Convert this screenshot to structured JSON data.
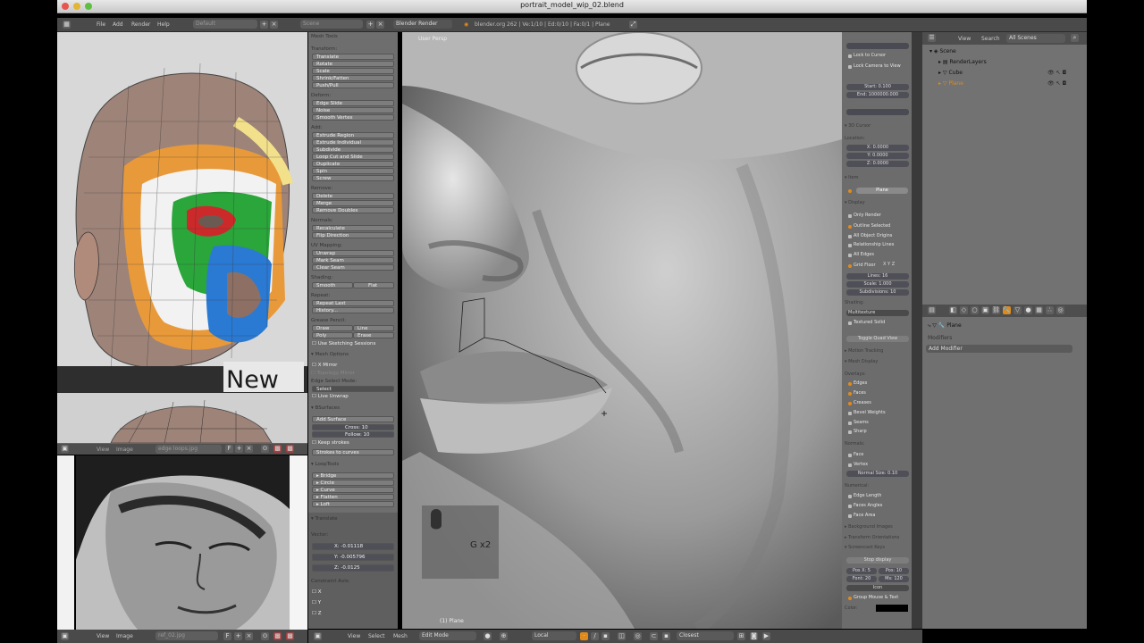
{
  "window": {
    "title": "portrait_model_wip_02.blend"
  },
  "info_header": {
    "menus": [
      "File",
      "Add",
      "Render",
      "Help"
    ],
    "layout": "Default",
    "scene": "Scene",
    "engine": "Blender Render",
    "stats": "blender.org 262 | Ve:1/10 | Ed:0/10 | Fa:0/1 | Plane"
  },
  "image_editor": {
    "overlay_text": "New",
    "image_name_top": "edge loops.jpg",
    "image_name_bottom": "ref_02.jpg",
    "menus": [
      "View",
      "Image"
    ]
  },
  "tool_shelf": {
    "header": "Mesh Tools",
    "groups": [
      {
        "title": "Transform:",
        "items": [
          "Translate",
          "Rotate",
          "Scale",
          "Shrink/Fatten",
          "Push/Pull"
        ]
      },
      {
        "title": "Deform:",
        "items": [
          "Edge Slide",
          "Noise",
          "Smooth Vertex"
        ]
      },
      {
        "title": "Add:",
        "items": [
          "Extrude Region",
          "Extrude Individual",
          "Subdivide",
          "Loop Cut and Slide",
          "Duplicate",
          "Spin",
          "Screw"
        ]
      },
      {
        "title": "Remove:",
        "items": [
          "Delete",
          "Merge",
          "Remove Doubles"
        ]
      },
      {
        "title": "Normals:",
        "items": [
          "Recalculate",
          "Flip Direction"
        ]
      },
      {
        "title": "UV Mapping:",
        "items": [
          "Unwrap",
          "Mark Seam",
          "Clear Seam"
        ]
      }
    ],
    "shading_label": "Shading:",
    "shading_smooth": "Smooth",
    "shading_flat": "Flat",
    "repeat_label": "Repeat:",
    "repeat_last": "Repeat Last",
    "history": "History...",
    "grease_label": "Grease Pencil:",
    "grease_draw": "Draw",
    "grease_line": "Line",
    "grease_poly": "Poly",
    "grease_erase": "Erase",
    "use_sketching": "Use Sketching Sessions",
    "mesh_options": "Mesh Options",
    "x_mirror": "X Mirror",
    "topology_mirror": "Topology Mirror",
    "edge_select_mode": "Edge Select Mode:",
    "select": "Select",
    "live_unwrap": "Live Unwrap",
    "bsurfaces": "BSurfaces",
    "add_surface": "Add Surface",
    "cross": "Cross: 10",
    "follow": "Follow: 10",
    "keep_strokes": "Keep strokes",
    "strokes_to_curves": "Strokes to curves",
    "looptools": "LoopTools",
    "loop_items": [
      "Bridge",
      "Circle",
      "Curve",
      "Flatten",
      "Loft"
    ],
    "translate_header": "Translate",
    "vector_label": "Vector:",
    "vx": "X: -0.01118",
    "vy": "Y: -0.005796",
    "vz": "Z: -0.0125",
    "constraint_axis": "Constraint Axis:",
    "axes": [
      "X",
      "Y",
      "Z"
    ]
  },
  "viewport": {
    "view_label": "User Persp",
    "object_label": "(1) Plane",
    "key_overlay": "G x2"
  },
  "properties_panel": {
    "lock_to_cursor": "Lock to Cursor",
    "lock_camera": "Lock Camera to View",
    "clip_start": "Start: 0.100",
    "clip_end": "End: 1000000.000",
    "cursor_3d": "3D Cursor",
    "location": "Location:",
    "cx": "X: 0.0000",
    "cy": "Y: 0.0000",
    "cz": "Z: 0.0000",
    "item": "Item",
    "item_name": "Plane",
    "display": "Display",
    "only_render": "Only Render",
    "outline_selected": "Outline Selected",
    "all_object_origins": "All Object Origins",
    "relationship_lines": "Relationship Lines",
    "all_edges": "All Edges",
    "grid_floor": "Grid Floor",
    "grid_axes": [
      "X",
      "Y",
      "Z"
    ],
    "lines": "Lines: 16",
    "scale": "Scale: 1.000",
    "subdivisions": "Subdivisions: 10",
    "shading": "Shading:",
    "multitexture": "Multitexture",
    "textured_solid": "Textured Solid",
    "toggle_quad": "Toggle Quad View",
    "motion_tracking": "Motion Tracking",
    "mesh_display": "Mesh Display",
    "overlays": "Overlays:",
    "edges": "Edges",
    "faces": "Faces",
    "creases": "Creases",
    "bevel_weights": "Bevel Weights",
    "seams": "Seams",
    "sharp": "Sharp",
    "normals": "Normals:",
    "face": "Face",
    "vertex": "Vertex",
    "normal_size": "Normal Size: 0.10",
    "numerical": "Numerical:",
    "edge_length": "Edge Length",
    "faces_angles": "Faces Angles",
    "face_area": "Face Area",
    "background_images": "Background Images",
    "transform_orientations": "Transform Orientations",
    "screencast_keys": "Screencast Keys",
    "stop_display": "Stop display",
    "pos_x": "Pos X: 5",
    "pos_y": "Pos: 10",
    "font": "Font: 20",
    "ms": "Ms: 120",
    "icon": "Icon",
    "group_mouse": "Group Mouse & Text",
    "color_label": "Color:"
  },
  "outliner": {
    "menus": [
      "View",
      "Search"
    ],
    "filter": "All Scenes",
    "tree": [
      "Scene",
      "RenderLayers",
      "Cube",
      "Plane"
    ]
  },
  "modifier_panel": {
    "object": "Plane",
    "modifiers_label": "Modifiers",
    "add_modifier": "Add Modifier"
  },
  "footer": {
    "menus": [
      "View",
      "Select",
      "Mesh"
    ],
    "mode": "Edit Mode",
    "pivot": "Local",
    "snap": "Closest",
    "img_menus": [
      "View",
      "Image"
    ],
    "img_name": "ref_02.jpg"
  },
  "colors": {
    "accent": "#e08a1e",
    "panel": "#6e6e6e",
    "header": "#4a4a4a"
  }
}
